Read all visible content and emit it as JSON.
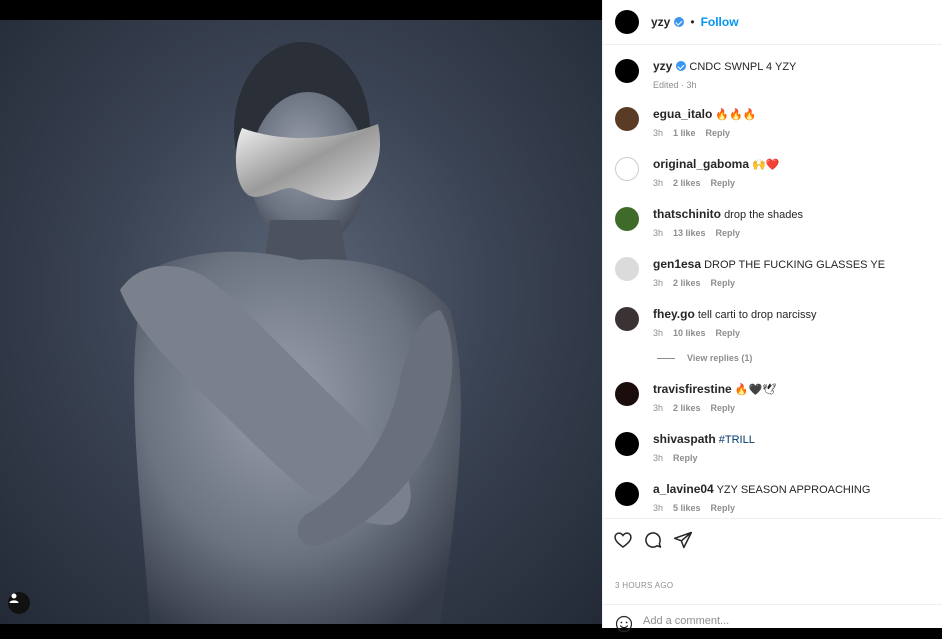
{
  "post": {
    "author": "yzy",
    "follow_label": "Follow",
    "dot": "•",
    "caption": "CNDC SWNPL 4 YZY",
    "caption_meta": "Edited · 3h",
    "time_label": "3 HOURS AGO"
  },
  "comments": [
    {
      "user": "egua_italo",
      "text": "🔥🔥🔥",
      "age": "3h",
      "likes": "1 like",
      "reply": "Reply"
    },
    {
      "user": "original_gaboma",
      "text": "🙌❤️",
      "age": "3h",
      "likes": "2 likes",
      "reply": "Reply"
    },
    {
      "user": "thatschinito",
      "text": "drop the shades",
      "age": "3h",
      "likes": "13 likes",
      "reply": "Reply"
    },
    {
      "user": "gen1esa",
      "text": "DROP THE FUCKING GLASSES YE",
      "age": "3h",
      "likes": "2 likes",
      "reply": "Reply"
    },
    {
      "user": "fhey.go",
      "text": "tell carti to drop narcissy",
      "age": "3h",
      "likes": "10 likes",
      "reply": "Reply"
    },
    {
      "user": "travisfirestine",
      "text": "🔥🖤🕊",
      "age": "3h",
      "likes": "2 likes",
      "reply": "Reply"
    },
    {
      "user": "shivaspath",
      "text": "#TRILL",
      "age": "3h",
      "likes": "",
      "reply": "Reply"
    },
    {
      "user": "a_lavine04",
      "text": "YZY SEASON APPROACHING",
      "age": "3h",
      "likes": "5 likes",
      "reply": "Reply"
    }
  ],
  "view_replies": "View replies (1)",
  "add_comment_placeholder": "Add a comment...",
  "icons": [
    "heart-icon",
    "comment-icon",
    "share-icon",
    "emoji-icon",
    "user-tag-icon",
    "verified-badge-icon"
  ],
  "colors": {
    "link": "#0095f6",
    "verified": "#3897f0",
    "hashtag": "#00376b"
  }
}
